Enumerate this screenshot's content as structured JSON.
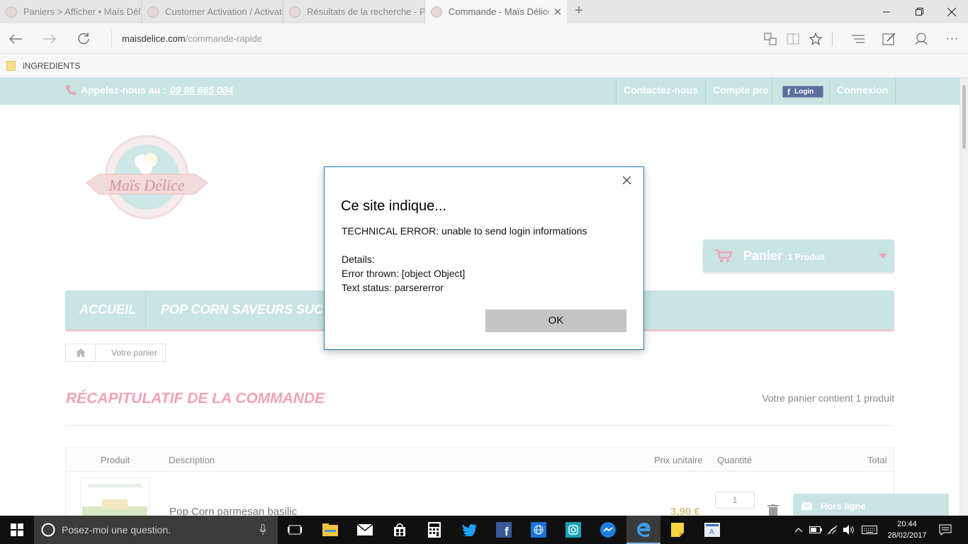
{
  "browser": {
    "tabs": [
      {
        "title": "Paniers > Afficher • Maïs Délice",
        "active": false
      },
      {
        "title": "Customer Activation / Activation",
        "active": false
      },
      {
        "title": "Résultats de la recherche - Pinterest",
        "active": false
      },
      {
        "title": "Commande - Maïs Délice",
        "active": true
      }
    ],
    "url_domain": "maisdelice.com",
    "url_path": "/commande-rapide",
    "favorites": [
      {
        "label": "iNGREDIENTS",
        "icon": "folder-icon"
      }
    ]
  },
  "site": {
    "phone_label": "Appelez-nous au :",
    "phone_number": "09 86 665 084",
    "top_links": {
      "contact": "Contactez-nous",
      "pro": "Compte pro",
      "fb_login": "Login",
      "connexion": "Connexion"
    },
    "logo_text": "Maïs Délice",
    "cart": {
      "title": "Panier",
      "count": "1 Produit"
    },
    "menu": [
      "ACCUEIL",
      "POP CORN SAVEURS SUCRÉES"
    ],
    "breadcrumb": "Votre panier",
    "heading": "RÉCAPITULATIF DE LA COMMANDE",
    "cart_summary": "Votre panier contient 1 produit",
    "table": {
      "headers": [
        "Produit",
        "Description",
        "Prix unitaire",
        "Quantité",
        "Total"
      ],
      "rows": [
        {
          "name": "Pop Corn parmesan basilic",
          "price": "3,90 €",
          "qty": "1"
        }
      ]
    },
    "chat": "Hors ligne"
  },
  "dialog": {
    "title": "Ce site indique...",
    "lines": [
      "TECHNICAL ERROR: unable to send login informations",
      "",
      "Details:",
      "Error thrown: [object Object]",
      "Text status: parsererror"
    ],
    "ok": "OK"
  },
  "taskbar": {
    "search_placeholder": "Posez-moi une question.",
    "time": "20:44",
    "date": "28/02/2017"
  },
  "colors": {
    "brand_teal": "#c8e4e3",
    "brand_pink": "#f0a3b5",
    "dialog_border": "#1a7fb5"
  }
}
